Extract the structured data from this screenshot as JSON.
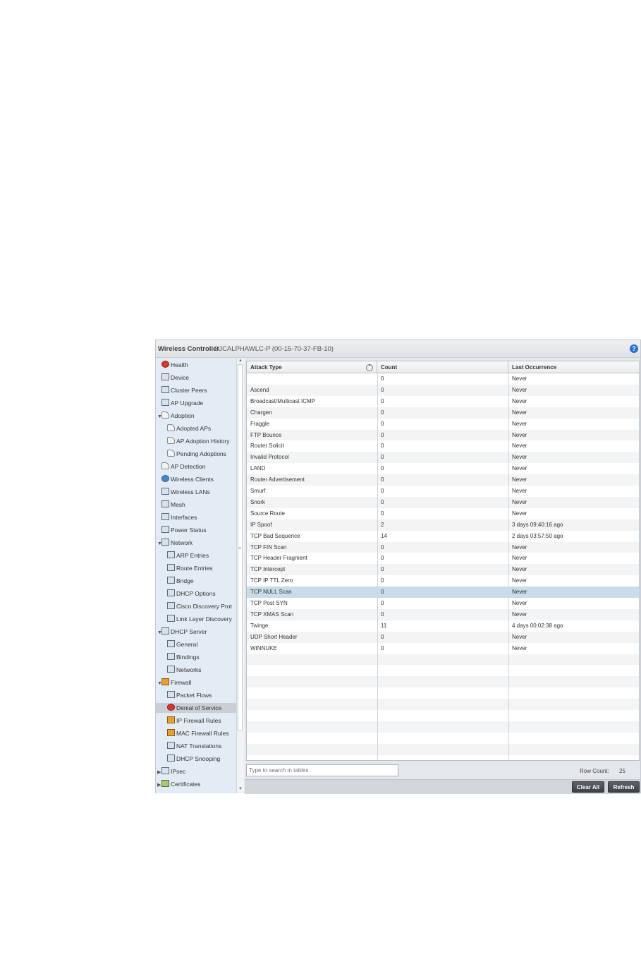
{
  "window": {
    "app_title": "Wireless Controller",
    "device_name": "SJCALPHAWLC-P (00-15-70-37-FB-10)",
    "help_label": "?"
  },
  "nav": {
    "items": [
      {
        "label": "Health",
        "icon": "health-icon",
        "level": 0,
        "expand": ""
      },
      {
        "label": "Device",
        "icon": "device-icon",
        "level": 0,
        "expand": ""
      },
      {
        "label": "Cluster Peers",
        "icon": "cluster-icon",
        "level": 0,
        "expand": ""
      },
      {
        "label": "AP Upgrade",
        "icon": "upgrade-icon",
        "level": 0,
        "expand": ""
      },
      {
        "label": "Adoption",
        "icon": "adoption-icon",
        "level": 0,
        "expand": "▼"
      },
      {
        "label": "Adopted APs",
        "icon": "adoption-icon",
        "level": 1,
        "expand": ""
      },
      {
        "label": "AP Adoption History",
        "icon": "adoption-icon",
        "level": 1,
        "expand": ""
      },
      {
        "label": "Pending Adoptions",
        "icon": "adoption-icon",
        "level": 1,
        "expand": ""
      },
      {
        "label": "AP Detection",
        "icon": "detection-icon",
        "level": 0,
        "expand": ""
      },
      {
        "label": "Wireless Clients",
        "icon": "clients-icon",
        "level": 0,
        "expand": ""
      },
      {
        "label": "Wireless LANs",
        "icon": "wlan-icon",
        "level": 0,
        "expand": ""
      },
      {
        "label": "Mesh",
        "icon": "mesh-icon",
        "level": 0,
        "expand": ""
      },
      {
        "label": "Interfaces",
        "icon": "interfaces-icon",
        "level": 0,
        "expand": ""
      },
      {
        "label": "Power Status",
        "icon": "power-icon",
        "level": 0,
        "expand": ""
      },
      {
        "label": "Network",
        "icon": "network-icon",
        "level": 0,
        "expand": "▼"
      },
      {
        "label": "ARP Entries",
        "icon": "arp-icon",
        "level": 1,
        "expand": ""
      },
      {
        "label": "Route Entries",
        "icon": "route-icon",
        "level": 1,
        "expand": ""
      },
      {
        "label": "Bridge",
        "icon": "bridge-icon",
        "level": 1,
        "expand": ""
      },
      {
        "label": "DHCP Options",
        "icon": "dhcp-icon",
        "level": 1,
        "expand": ""
      },
      {
        "label": "Cisco Discovery Prot",
        "icon": "cdp-icon",
        "level": 1,
        "expand": ""
      },
      {
        "label": "Link Layer Discovery",
        "icon": "lldp-icon",
        "level": 1,
        "expand": ""
      },
      {
        "label": "DHCP Server",
        "icon": "dhcp-server-icon",
        "level": 0,
        "expand": "▼"
      },
      {
        "label": "General",
        "icon": "general-icon",
        "level": 1,
        "expand": ""
      },
      {
        "label": "Bindings",
        "icon": "bindings-icon",
        "level": 1,
        "expand": ""
      },
      {
        "label": "Networks",
        "icon": "networks-icon",
        "level": 1,
        "expand": ""
      },
      {
        "label": "Firewall",
        "icon": "firewall-icon",
        "level": 0,
        "expand": "▼"
      },
      {
        "label": "Packet Flows",
        "icon": "packet-flows-icon",
        "level": 1,
        "expand": ""
      },
      {
        "label": "Denial of Service",
        "icon": "denial-of-service-icon",
        "level": 1,
        "expand": "",
        "selected": true
      },
      {
        "label": "IP Firewall Rules",
        "icon": "ip-firewall-icon",
        "level": 1,
        "expand": ""
      },
      {
        "label": "MAC Firewall Rules",
        "icon": "mac-firewall-icon",
        "level": 1,
        "expand": ""
      },
      {
        "label": "NAT Translations",
        "icon": "nat-icon",
        "level": 1,
        "expand": ""
      },
      {
        "label": "DHCP Snooping",
        "icon": "dhcp-snooping-icon",
        "level": 1,
        "expand": ""
      },
      {
        "label": "IPsec",
        "icon": "ipsec-icon",
        "level": 0,
        "expand": "▶"
      },
      {
        "label": "Certificates",
        "icon": "certificates-icon",
        "level": 0,
        "expand": "▶"
      }
    ]
  },
  "table": {
    "columns": [
      "Attack Type",
      "Count",
      "Last Occurrence"
    ],
    "rows": [
      [
        "",
        "0",
        "Never"
      ],
      [
        "Ascend",
        "0",
        "Never"
      ],
      [
        "Broadcast/Multicast ICMP",
        "0",
        "Never"
      ],
      [
        "Chargen",
        "0",
        "Never"
      ],
      [
        "Fraggle",
        "0",
        "Never"
      ],
      [
        "FTP Bounce",
        "0",
        "Never"
      ],
      [
        "Router Solicit",
        "0",
        "Never"
      ],
      [
        "Invalid Protocol",
        "0",
        "Never"
      ],
      [
        "LAND",
        "0",
        "Never"
      ],
      [
        "Router Advertisement",
        "0",
        "Never"
      ],
      [
        "Smurf",
        "0",
        "Never"
      ],
      [
        "Snork",
        "0",
        "Never"
      ],
      [
        "Source Route",
        "0",
        "Never"
      ],
      [
        "IP Spoof",
        "2",
        "3 days 09:40:16 ago"
      ],
      [
        "TCP Bad Sequence",
        "14",
        "2 days 03:57:50 ago"
      ],
      [
        "TCP FIN Scan",
        "0",
        "Never"
      ],
      [
        "TCP Header Fragment",
        "0",
        "Never"
      ],
      [
        "TCP Intercept",
        "0",
        "Never"
      ],
      [
        "TCP IP TTL Zero",
        "0",
        "Never"
      ],
      [
        "TCP NULL Scan",
        "0",
        "Never"
      ],
      [
        "TCP Post SYN",
        "0",
        "Never"
      ],
      [
        "TCP XMAS Scan",
        "0",
        "Never"
      ],
      [
        "Twinge",
        "11",
        "4 days 00:02:38 ago"
      ],
      [
        "UDP Short Header",
        "0",
        "Never"
      ],
      [
        "WINNUKE",
        "0",
        "Never"
      ]
    ],
    "selected_row": "TCP NULL Scan"
  },
  "footer": {
    "search_placeholder": "Type to search in tables",
    "row_count_label": "Row Count:",
    "row_count_value": "25",
    "clear_all_label": "Clear All",
    "refresh_label": "Refresh"
  }
}
